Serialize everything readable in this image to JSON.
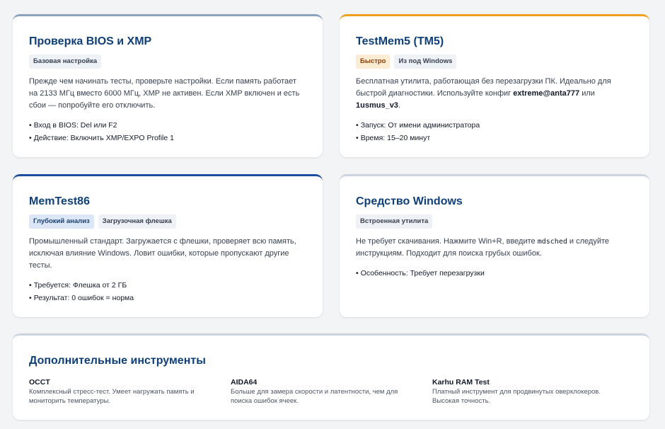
{
  "cards": [
    {
      "title": "Проверка BIOS и XMP",
      "tags": [
        "Базовая настройка"
      ],
      "desc": "Прежде чем начинать тесты, проверьте настройки. Если память работает на 2133 МГц вместо 6000 МГц, XMP не активен. Если XMP включен и есть сбои — попробуйте его отключить.",
      "facts": [
        "Вход в BIOS: Del или F2",
        "Действие: Включить XMP/EXPO Profile 1"
      ]
    },
    {
      "title": "TestMem5 (TM5)",
      "tags": [
        "Быстро",
        "Из под Windows"
      ],
      "desc_before": "Бесплатная утилита, работающая без перезагрузки ПК. Идеально для быстрой диагностики. Используйте конфиг ",
      "desc_bold1": "extreme@anta777",
      "desc_mid": " или ",
      "desc_bold2": "1usmus_v3",
      "desc_after": ".",
      "facts": [
        "Запуск: От имени администратора",
        "Время: 15–20 минут"
      ]
    },
    {
      "title": "MemTest86",
      "tags": [
        "Глубокий анализ",
        "Загрузочная флешка"
      ],
      "desc": "Промышленный стандарт. Загружается с флешки, проверяет всю память, исключая влияние Windows. Ловит ошибки, которые пропускают другие тесты.",
      "facts": [
        "Требуется: Флешка от 2 ГБ",
        "Результат: 0 ошибок = норма"
      ]
    },
    {
      "title": "Средство Windows",
      "tags": [
        "Встроенная утилита"
      ],
      "desc_before": "Не требует скачивания. Нажмите Win+R, введите ",
      "desc_code": "mdsched",
      "desc_after": " и следуйте инструкциям. Подходит для поиска грубых ошибок.",
      "facts": [
        "Особенность: Требует перезагрузки"
      ]
    }
  ],
  "extra": {
    "title": "Дополнительные инструменты",
    "tools": [
      {
        "name": "OCCT",
        "desc": "Комплексный стресс-тест. Умеет нагружать память и мониторить температуры."
      },
      {
        "name": "AIDA64",
        "desc": "Больше для замера скорости и латентности, чем для поиска ошибок ячеек."
      },
      {
        "name": "Karhu RAM Test",
        "desc": "Платный инструмент для продвинутых оверклокеров. Высокая точность."
      }
    ]
  },
  "bullet": "•"
}
